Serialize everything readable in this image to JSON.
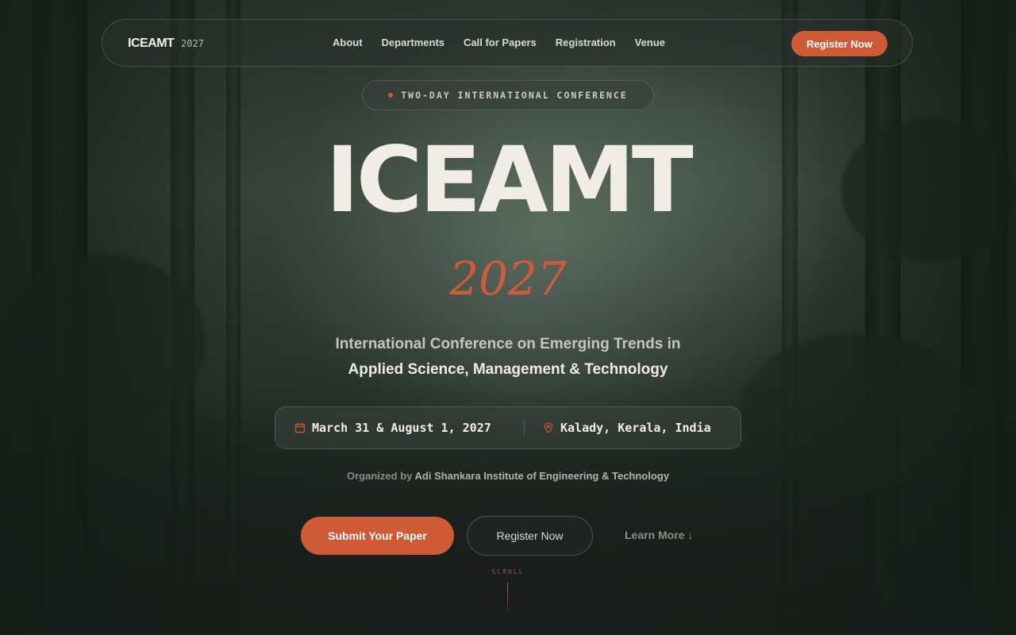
{
  "nav": {
    "brand": "ICEAMT",
    "brand_year": "2027",
    "links": [
      "About",
      "Departments",
      "Call for Papers",
      "Registration",
      "Venue"
    ],
    "cta": "Register Now"
  },
  "hero": {
    "badge": "TWO-DAY INTERNATIONAL CONFERENCE",
    "title": "ICEAMT",
    "year": "2027",
    "subtitle_line1": "International Conference on Emerging Trends in",
    "subtitle_line2": "Applied Science, Management & Technology",
    "dates": "March 31 & August 1, 2027",
    "location": "Kalady, Kerala, India",
    "organized_prefix": "Organized by",
    "organizer": "Adi Shankara Institute of Engineering & Technology",
    "primary_button": "Submit Your Paper",
    "secondary_button": "Register Now",
    "learn_more": "Learn More ↓",
    "scroll_label": "SCROLL"
  },
  "icons": {
    "dates": "calendar-icon",
    "location": "map-pin-icon"
  },
  "colors": {
    "accent": "#cf5a36",
    "text": "#f1ede6",
    "background": "#1d2320"
  }
}
